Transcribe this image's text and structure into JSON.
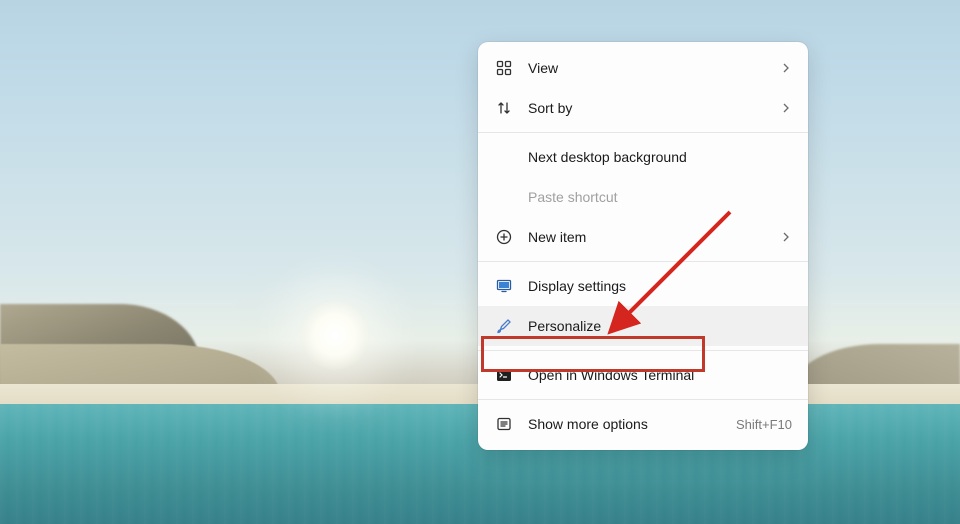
{
  "menu": {
    "items": [
      {
        "label": "View",
        "hasSubmenu": true
      },
      {
        "label": "Sort by",
        "hasSubmenu": true
      },
      {
        "label": "Next desktop background"
      },
      {
        "label": "Paste shortcut",
        "disabled": true
      },
      {
        "label": "New item",
        "hasSubmenu": true
      },
      {
        "label": "Display settings"
      },
      {
        "label": "Personalize",
        "hovered": true
      },
      {
        "label": "Open in Windows Terminal"
      },
      {
        "label": "Show more options",
        "shortcut": "Shift+F10"
      }
    ]
  },
  "annotation": {
    "highlightItemIndex": 6
  }
}
